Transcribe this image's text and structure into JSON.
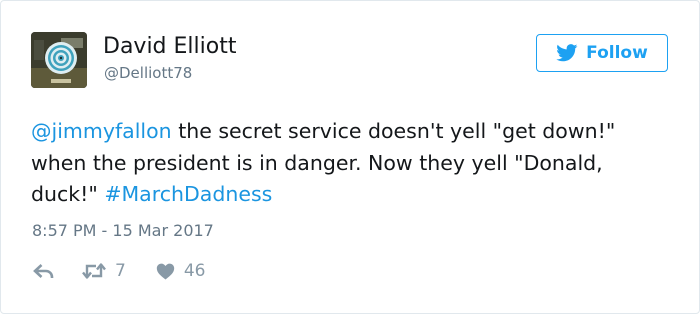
{
  "tweet": {
    "author": {
      "name": "David Elliott",
      "handle": "@Delliott78",
      "avatar_icon": "spiral-disc-avatar-icon"
    },
    "follow_button": {
      "label": "Follow",
      "icon": "twitter-bird-icon",
      "color": "#1da1f2"
    },
    "text": {
      "mention": "@jimmyfallon",
      "body": " the secret service doesn't yell \"get down!\" when the president is in danger. Now they yell \"Donald, duck!\" ",
      "hashtag": "#MarchDadness",
      "link_color": "#1b95e0"
    },
    "timestamp": "8:57 PM - 15 Mar 2017",
    "actions": {
      "reply_icon": "reply-arrow-icon",
      "retweet_icon": "retweet-icon",
      "retweet_count": "7",
      "like_icon": "heart-icon",
      "like_count": "46"
    }
  }
}
